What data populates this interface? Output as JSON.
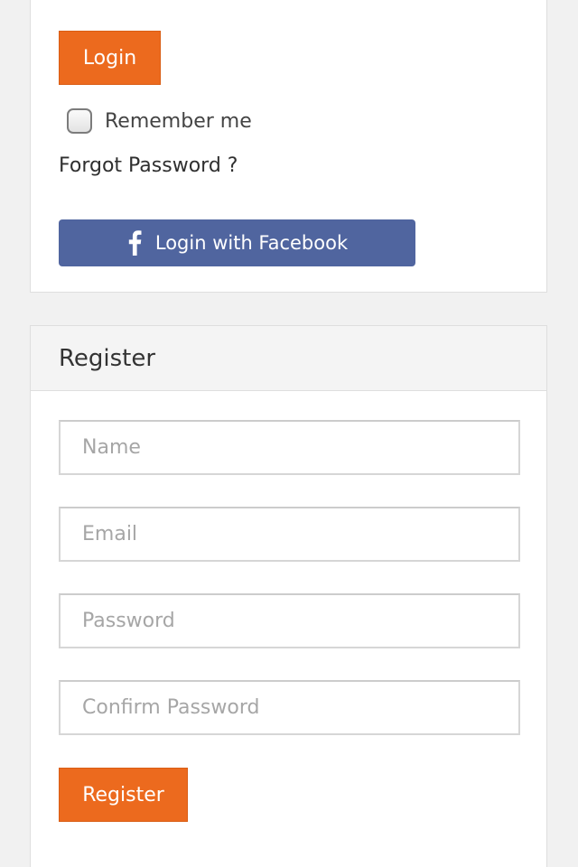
{
  "login": {
    "login_button": "Login",
    "remember_label": "Remember me",
    "remember_checked": false,
    "forgot_password": "Forgot Password ?",
    "facebook_button": "Login with Facebook"
  },
  "register": {
    "title": "Register",
    "fields": {
      "name_placeholder": "Name",
      "email_placeholder": "Email",
      "password_placeholder": "Password",
      "confirm_password_placeholder": "Confirm Password"
    },
    "register_button": "Register"
  },
  "icons": {
    "facebook": "facebook-f-icon"
  },
  "colors": {
    "accent": "#ec6a1e",
    "facebook": "#50659f",
    "background": "#f1f1f1"
  }
}
